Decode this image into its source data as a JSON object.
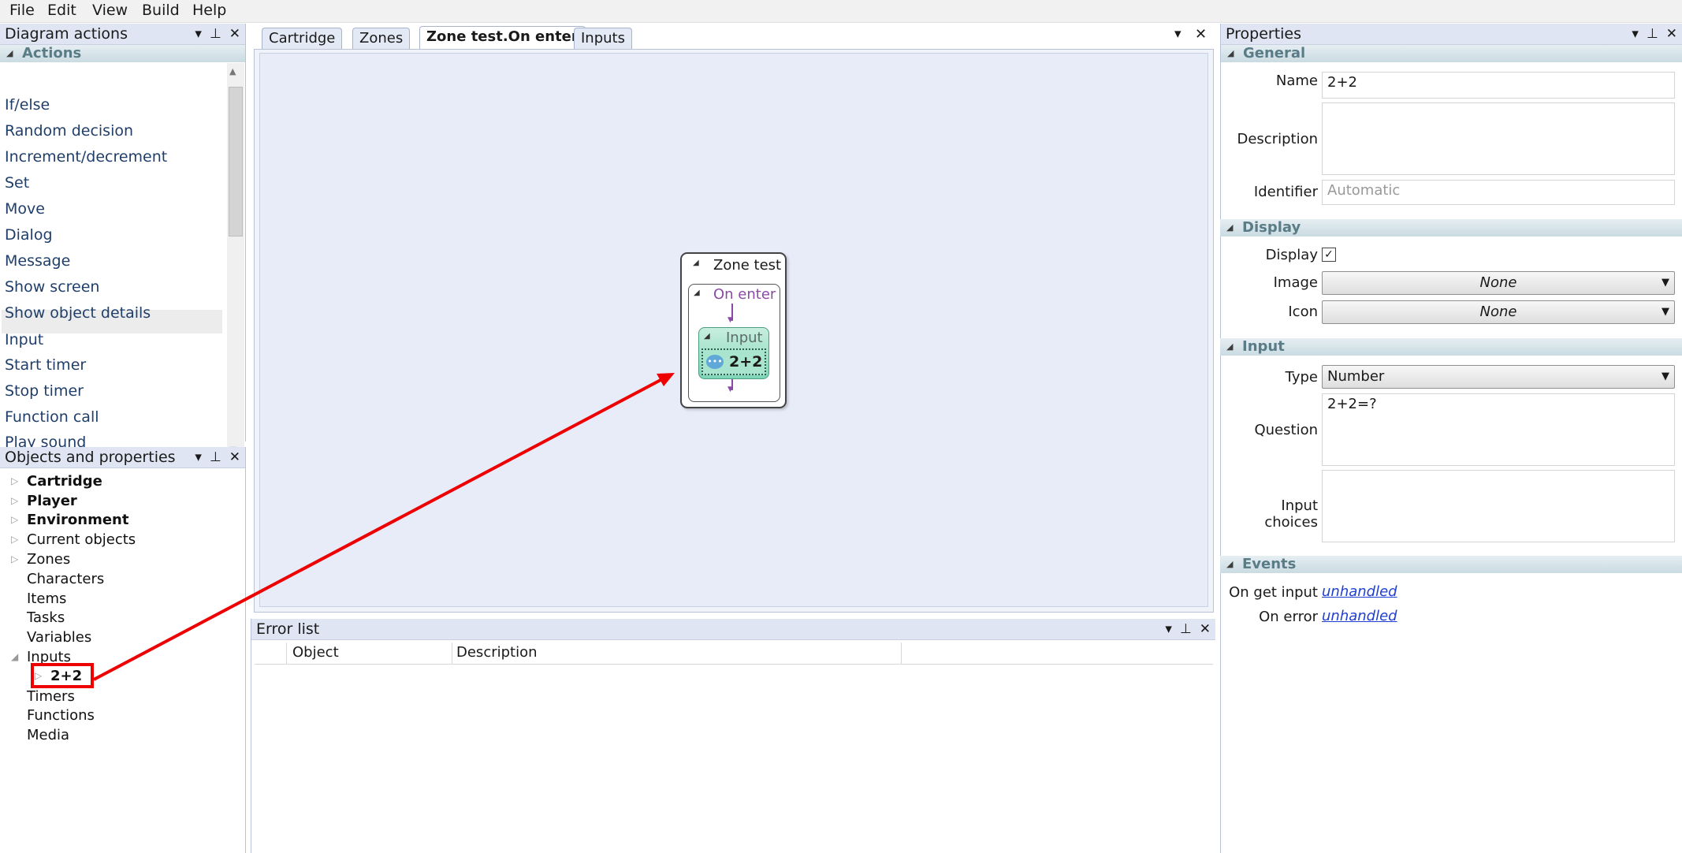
{
  "menu": [
    "File",
    "Edit",
    "View",
    "Build",
    "Help"
  ],
  "diagram_actions": {
    "title": "Diagram actions",
    "section": "Actions",
    "items": [
      "If/else",
      "Random decision",
      "Increment/decrement",
      "Set",
      "Move",
      "Dialog",
      "Message",
      "Show screen",
      "Show object details",
      "Input",
      "Start timer",
      "Stop timer",
      "Function call",
      "Play sound"
    ],
    "selected_index": 9
  },
  "objects": {
    "title": "Objects and properties",
    "items": [
      "Cartridge",
      "Player",
      "Environment",
      "Current objects",
      "Zones",
      "Characters",
      "Items",
      "Tasks",
      "Variables",
      "Inputs",
      "2+2",
      "Timers",
      "Functions",
      "Media"
    ]
  },
  "tabs": [
    "Cartridge",
    "Zones",
    "Zone test.On enter",
    "Inputs"
  ],
  "active_tab": "Zone test.On enter",
  "diagram": {
    "zone_title": "Zone test",
    "event_title": "On enter",
    "node_title": "Input",
    "node_value": "2+2"
  },
  "error_list": {
    "title": "Error list",
    "columns": [
      "Object",
      "Description"
    ]
  },
  "properties": {
    "title": "Properties",
    "general": {
      "section": "General",
      "name_label": "Name",
      "name_value": "2+2",
      "description_label": "Description",
      "description_value": "",
      "identifier_label": "Identifier",
      "identifier_placeholder": "Automatic"
    },
    "display": {
      "section": "Display",
      "display_label": "Display",
      "display_checked": "✓",
      "image_label": "Image",
      "image_value": "None",
      "icon_label": "Icon",
      "icon_value": "None"
    },
    "input": {
      "section": "Input",
      "type_label": "Type",
      "type_value": "Number",
      "question_label": "Question",
      "question_value": "2+2=?",
      "choices_label": "Input choices",
      "choices_value": ""
    },
    "events": {
      "section": "Events",
      "get_input_label": "On get input",
      "get_input_value": "unhandled",
      "on_error_label": "On error",
      "on_error_value": "unhandled"
    }
  },
  "colors": {
    "panel_header": "#dfe5f3",
    "canvas": "#e8ecf8",
    "annotation": "#ee0000",
    "node_green": "#7fd6b8"
  }
}
